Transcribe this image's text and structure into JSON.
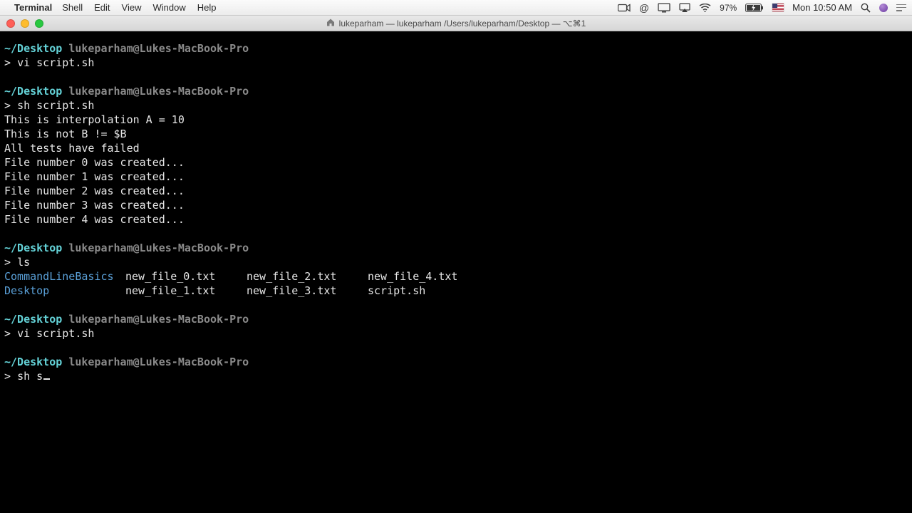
{
  "menubar": {
    "app": "Terminal",
    "items": [
      "Shell",
      "Edit",
      "View",
      "Window",
      "Help"
    ],
    "battery_pct": "97%",
    "battery_icon_state": "charging",
    "clock": "Mon 10:50 AM"
  },
  "window": {
    "title": "lukeparham — lukeparham /Users/lukeparham/Desktop — ⌥⌘1"
  },
  "prompt": {
    "path": "~/Desktop",
    "user": "lukeparham@Lukes-MacBook-Pro",
    "symbol": ">"
  },
  "session": [
    {
      "cmd": "vi script.sh",
      "output": []
    },
    {
      "cmd": "sh script.sh",
      "output": [
        "This is interpolation A = 10",
        "This is not B != $B",
        "All tests have failed",
        "File number 0 was created...",
        "File number 1 was created...",
        "File number 2 was created...",
        "File number 3 was created...",
        "File number 4 was created..."
      ]
    },
    {
      "cmd": "ls",
      "ls": {
        "rows": [
          [
            {
              "t": "CommandLineBasics",
              "dir": true
            },
            {
              "t": "new_file_0.txt",
              "dir": false
            },
            {
              "t": "new_file_2.txt",
              "dir": false
            },
            {
              "t": "new_file_4.txt",
              "dir": false
            }
          ],
          [
            {
              "t": "Desktop",
              "dir": true
            },
            {
              "t": "new_file_1.txt",
              "dir": false
            },
            {
              "t": "new_file_3.txt",
              "dir": false
            },
            {
              "t": "script.sh",
              "dir": false
            }
          ]
        ]
      }
    },
    {
      "cmd": "vi script.sh",
      "output": []
    }
  ],
  "current_input": "sh s"
}
